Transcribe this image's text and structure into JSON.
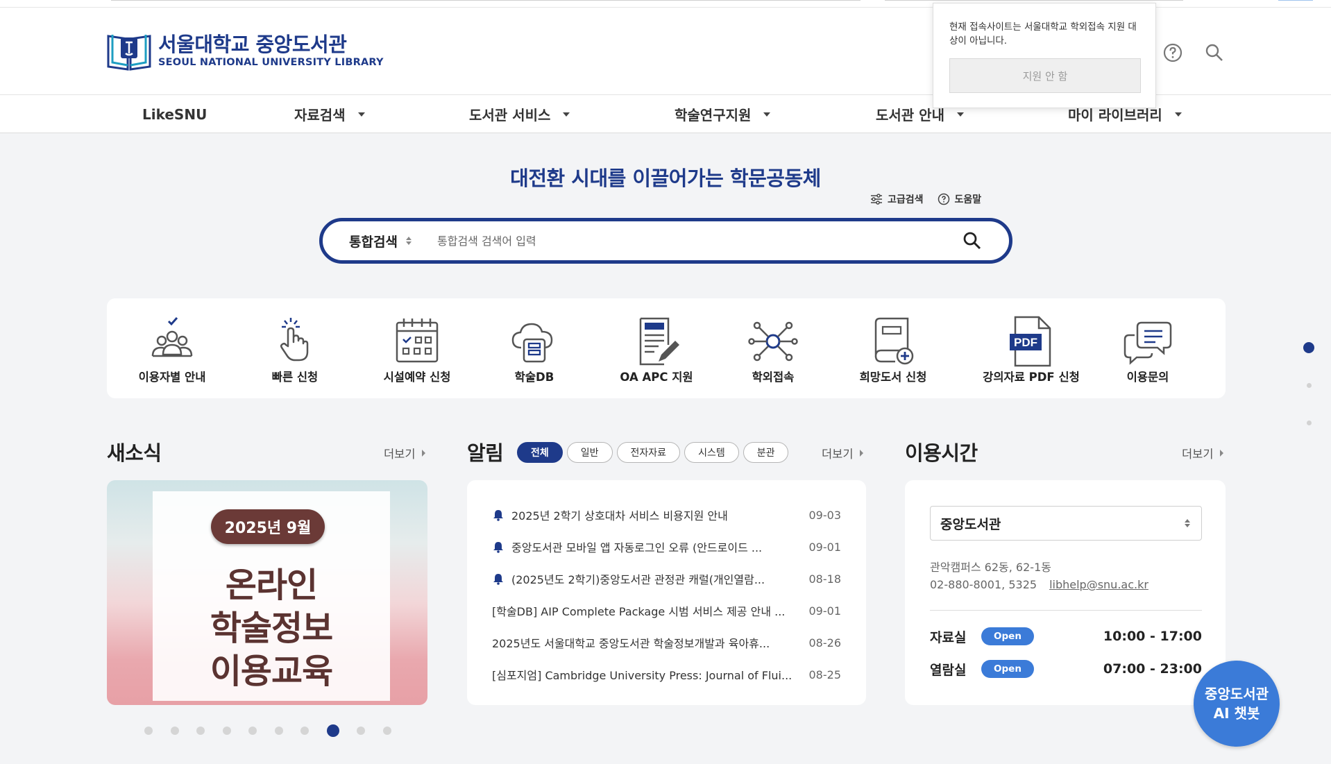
{
  "header": {
    "logo_ko": "서울대학교 중앙도서관",
    "logo_en": "SEOUL NATIONAL UNIVERSITY LIBRARY",
    "icons": [
      "help-icon",
      "search-icon"
    ]
  },
  "popup": {
    "message": "현재 접속사이트는 서울대학교 학외접속 지원 대상이 아닙니다.",
    "button": "지원 안 함"
  },
  "nav": {
    "items": [
      {
        "label": "LikeSNU",
        "has_dropdown": false
      },
      {
        "label": "자료검색",
        "has_dropdown": true
      },
      {
        "label": "도서관 서비스",
        "has_dropdown": true
      },
      {
        "label": "학술연구지원",
        "has_dropdown": true
      },
      {
        "label": "도서관 안내",
        "has_dropdown": true
      },
      {
        "label": "마이 라이브러리",
        "has_dropdown": true
      }
    ]
  },
  "hero": {
    "title": "대전환 시대를 이끌어가는 학문공동체",
    "advanced_search": "고급검색",
    "help": "도움말",
    "search_type": "통합검색",
    "search_placeholder": "통합검색 검색어 입력"
  },
  "quick_links": [
    {
      "label": "이용자별 안내",
      "icon": "users-check-icon"
    },
    {
      "label": "빠른 신청",
      "icon": "tap-hand-icon"
    },
    {
      "label": "시설예약 신청",
      "icon": "calendar-icon"
    },
    {
      "label": "학술DB",
      "icon": "cloud-database-icon"
    },
    {
      "label": "OA APC 지원",
      "icon": "document-edit-icon"
    },
    {
      "label": "학외접속",
      "icon": "network-icon"
    },
    {
      "label": "희망도서 신청",
      "icon": "book-add-icon"
    },
    {
      "label": "강의자료 PDF 신청",
      "icon": "pdf-file-icon"
    },
    {
      "label": "이용문의",
      "icon": "chat-bubbles-icon"
    }
  ],
  "news": {
    "title": "새소식",
    "more": "더보기",
    "banner_pill": "2025년 9월",
    "banner_lines": [
      "온라인",
      "학술정보",
      "이용교육"
    ],
    "pager_count": 10,
    "pager_active": 8
  },
  "notice": {
    "title": "알림",
    "more": "더보기",
    "chips": [
      {
        "label": "전체",
        "active": true
      },
      {
        "label": "일반",
        "active": false
      },
      {
        "label": "전자자료",
        "active": false
      },
      {
        "label": "시스템",
        "active": false
      },
      {
        "label": "분관",
        "active": false
      }
    ],
    "items": [
      {
        "pinned": true,
        "title": "2025년 2학기 상호대차 서비스 비용지원 안내",
        "date": "09-03"
      },
      {
        "pinned": true,
        "title": "중앙도서관 모바일 앱 자동로그인 오류 (안드로이드 ...",
        "date": "09-01"
      },
      {
        "pinned": true,
        "title": "(2025년도 2학기)중앙도서관 관정관 캐럴(개인열람...",
        "date": "08-18"
      },
      {
        "pinned": false,
        "title": "[학술DB] AIP Complete Package 시범 서비스 제공 안내 ...",
        "date": "09-01"
      },
      {
        "pinned": false,
        "title": "2025년도 서울대학교 중앙도서관 학술정보개발과 육아휴...",
        "date": "08-26"
      },
      {
        "pinned": false,
        "title": "[심포지엄] Cambridge University Press: Journal of Flui...",
        "date": "08-25"
      }
    ]
  },
  "hours": {
    "title": "이용시간",
    "more": "더보기",
    "library": "중앙도서관",
    "address": "관악캠퍼스 62동, 62-1동",
    "phone": "02-880-8001, 5325",
    "email": "libhelp@snu.ac.kr",
    "rooms": [
      {
        "name": "자료실",
        "status": "Open",
        "time": "10:00 - 17:00"
      },
      {
        "name": "열람실",
        "status": "Open",
        "time": "07:00 - 23:00"
      }
    ]
  },
  "chatbot": {
    "line1": "중앙도서관",
    "line2": "AI 챗봇"
  },
  "colors": {
    "brand": "#1e3a8a",
    "accent": "#3b7bd8",
    "banner_text": "#5b3331"
  }
}
